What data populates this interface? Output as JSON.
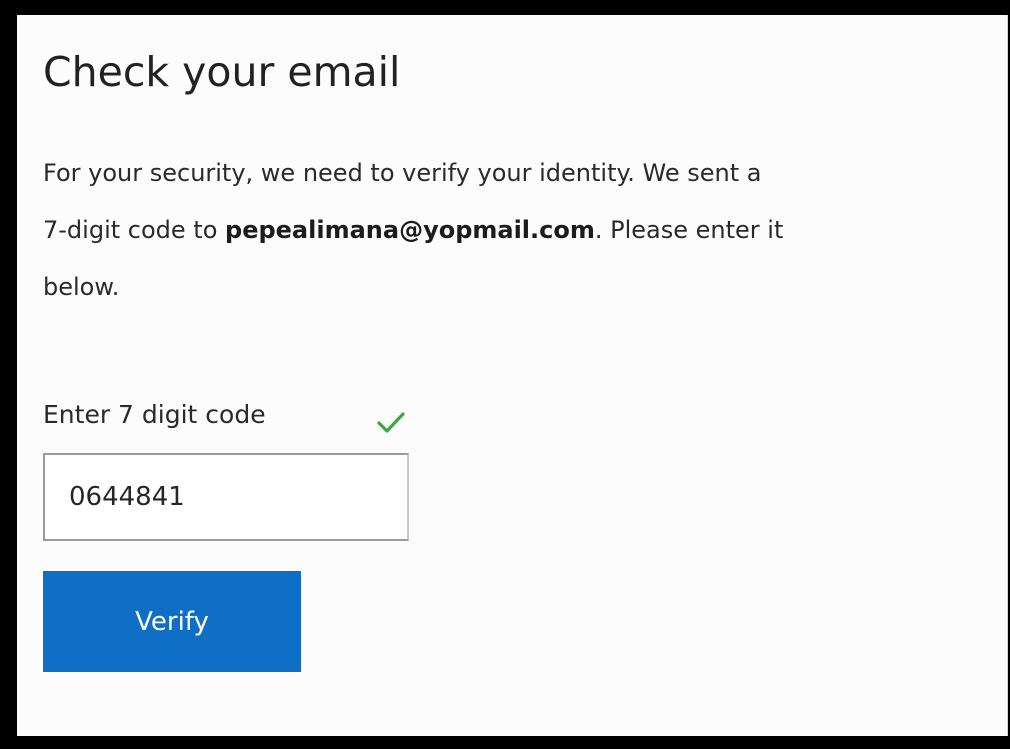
{
  "heading": "Check your email",
  "description": {
    "line1": "For your security, we need to verify your identity. We sent a",
    "line2_prefix": "7-digit code to ",
    "email": "pepealimana@yopmail.com",
    "line2_suffix": ". Please enter it",
    "line3": "below."
  },
  "form": {
    "code_label": "Enter 7 digit code",
    "code_value": "0644841",
    "valid_icon": "checkmark-icon",
    "verify_label": "Verify"
  },
  "colors": {
    "button_bg": "#0f6fc6",
    "button_text": "#ffffff",
    "check": "#3aa83f",
    "frame": "#000000"
  }
}
